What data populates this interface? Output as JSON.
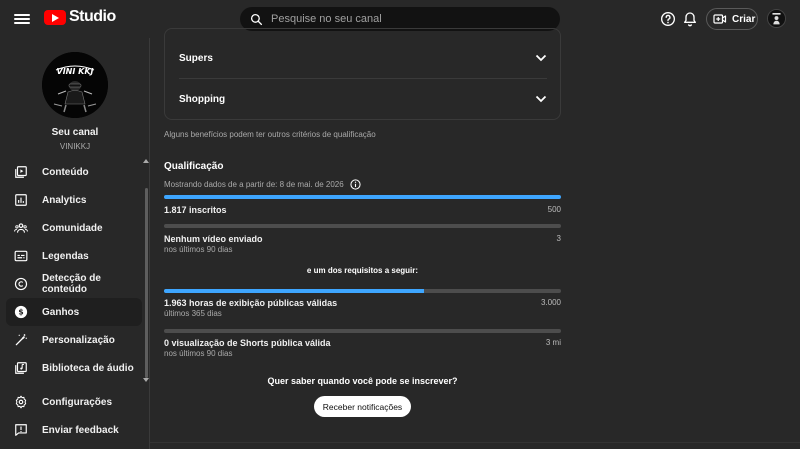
{
  "header": {
    "logo_text": "Studio",
    "search_placeholder": "Pesquise no seu canal",
    "create_label": "Criar",
    "avatar_text": "VINI KKJ"
  },
  "sidebar": {
    "avatar_text": "VINI KKJ",
    "channel_title": "Seu canal",
    "channel_handle": "VINIKKJ",
    "items": [
      {
        "label": "Conteúdo",
        "icon": "content-icon"
      },
      {
        "label": "Analytics",
        "icon": "analytics-icon"
      },
      {
        "label": "Comunidade",
        "icon": "community-icon"
      },
      {
        "label": "Legendas",
        "icon": "subtitles-icon"
      },
      {
        "label": "Detecção de conteúdo",
        "icon": "copyright-icon"
      },
      {
        "label": "Ganhos",
        "icon": "earn-icon",
        "active": true
      },
      {
        "label": "Personalização",
        "icon": "customization-icon"
      },
      {
        "label": "Biblioteca de áudio",
        "icon": "audio-library-icon"
      }
    ],
    "bottom_items": [
      {
        "label": "Configurações",
        "icon": "settings-icon"
      },
      {
        "label": "Enviar feedback",
        "icon": "feedback-icon"
      }
    ]
  },
  "main": {
    "benefits": [
      {
        "label": "Supers"
      },
      {
        "label": "Shopping"
      }
    ],
    "note": "Alguns benefícios podem ter outros critérios de qualificação",
    "qualification": {
      "title": "Qualificação",
      "subtitle": "Mostrando dados de a partir de: 8 de mai. de 2026",
      "requirements": [
        {
          "label": "1.817 inscritos",
          "target": "500",
          "sub": "",
          "progress": 1.0
        },
        {
          "label": "Nenhum vídeo enviado",
          "target": "3",
          "sub": "nos últimos 90 dias",
          "progress": 0.0
        }
      ],
      "or_text": "e um dos requisitos a seguir:",
      "alternatives": [
        {
          "label": "1.963 horas de exibição públicas válidas",
          "target": "3.000",
          "sub": "últimos 365 dias",
          "progress": 0.654
        },
        {
          "label": "0 visualização de Shorts pública válida",
          "target": "3 mi",
          "sub": "nos últimos 90 dias",
          "progress": 0.0
        }
      ]
    },
    "cta_text": "Quer saber quando você pode se inscrever?",
    "notify_button": "Receber notificações"
  },
  "colors": {
    "background": "#282828",
    "search_bg": "#121212",
    "progress_fill": "#3ea6ff",
    "progress_track": "#4d4d4d",
    "logo_red": "#ff0000"
  }
}
